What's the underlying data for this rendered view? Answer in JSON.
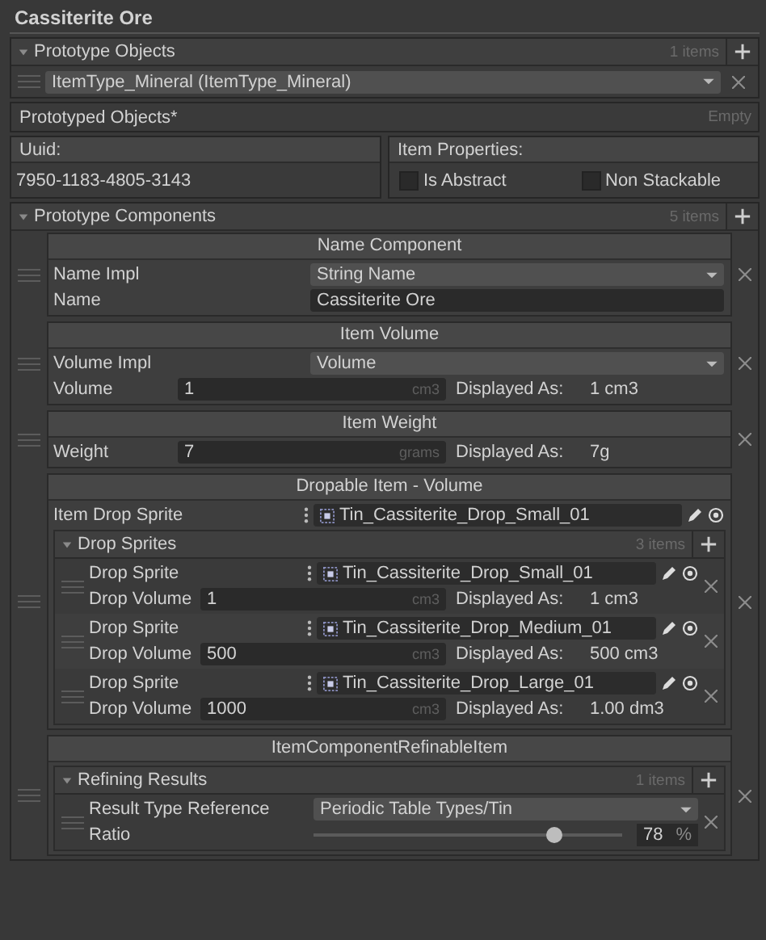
{
  "title": "Cassiterite Ore",
  "prototype_objects": {
    "label": "Prototype Objects",
    "count": "1 items",
    "expanded": true,
    "items": [
      "ItemType_Mineral (ItemType_Mineral)"
    ]
  },
  "prototyped_objects": {
    "label": "Prototyped Objects*",
    "status": "Empty"
  },
  "uuid": {
    "label": "Uuid:",
    "value": "7950-1183-4805-3143"
  },
  "item_properties": {
    "label": "Item Properties:",
    "flags": [
      {
        "label": "Is Abstract",
        "checked": false
      },
      {
        "label": "Non Stackable",
        "checked": false
      }
    ]
  },
  "components": {
    "label": "Prototype Components",
    "count": "5 items",
    "expanded": true,
    "items": [
      {
        "title": "Name Component",
        "fields": [
          {
            "kind": "dropdown",
            "label": "Name Impl",
            "value": "String Name"
          },
          {
            "kind": "text",
            "label": "Name",
            "value": "Cassiterite Ore"
          }
        ]
      },
      {
        "title": "Item Volume",
        "fields": [
          {
            "kind": "dropdown",
            "label": "Volume Impl",
            "value": "Volume"
          },
          {
            "kind": "unit",
            "label": "Volume",
            "value": "1",
            "unit": "cm3",
            "display_label": "Displayed As:",
            "display": "1 cm3"
          }
        ]
      },
      {
        "title": "Item Weight",
        "fields": [
          {
            "kind": "unit",
            "label": "Weight",
            "value": "7",
            "unit": "grams",
            "display_label": "Displayed As:",
            "display": "7g"
          }
        ]
      },
      {
        "title": "Dropable Item - Volume",
        "fields": [
          {
            "kind": "object",
            "label": "Item Drop Sprite",
            "value": "Tin_Cassiterite_Drop_Small_01"
          },
          {
            "kind": "list",
            "label": "Drop Sprites",
            "count": "3 items",
            "expanded": true,
            "items": [
              {
                "fields": [
                  {
                    "kind": "object",
                    "label": "Drop Sprite",
                    "value": "Tin_Cassiterite_Drop_Small_01"
                  },
                  {
                    "kind": "unit",
                    "label": "Drop Volume",
                    "value": "1",
                    "unit": "cm3",
                    "display_label": "Displayed As:",
                    "display": "1 cm3"
                  }
                ]
              },
              {
                "fields": [
                  {
                    "kind": "object",
                    "label": "Drop Sprite",
                    "value": "Tin_Cassiterite_Drop_Medium_01"
                  },
                  {
                    "kind": "unit",
                    "label": "Drop Volume",
                    "value": "500",
                    "unit": "cm3",
                    "display_label": "Displayed As:",
                    "display": "500 cm3"
                  }
                ]
              },
              {
                "fields": [
                  {
                    "kind": "object",
                    "label": "Drop Sprite",
                    "value": "Tin_Cassiterite_Drop_Large_01"
                  },
                  {
                    "kind": "unit",
                    "label": "Drop Volume",
                    "value": "1000",
                    "unit": "cm3",
                    "display_label": "Displayed As:",
                    "display": "1.00 dm3"
                  }
                ]
              }
            ]
          }
        ]
      },
      {
        "title": "ItemComponentRefinableItem",
        "fields": [
          {
            "kind": "list",
            "label": "Refining Results",
            "count": "1 items",
            "expanded": true,
            "items": [
              {
                "fields": [
                  {
                    "kind": "dropdown",
                    "label": "Result Type Reference",
                    "value": "Periodic Table Types/Tin"
                  },
                  {
                    "kind": "slider",
                    "label": "Ratio",
                    "level": 0.78,
                    "value": "78",
                    "unit": "%"
                  }
                ]
              }
            ]
          }
        ]
      }
    ]
  }
}
